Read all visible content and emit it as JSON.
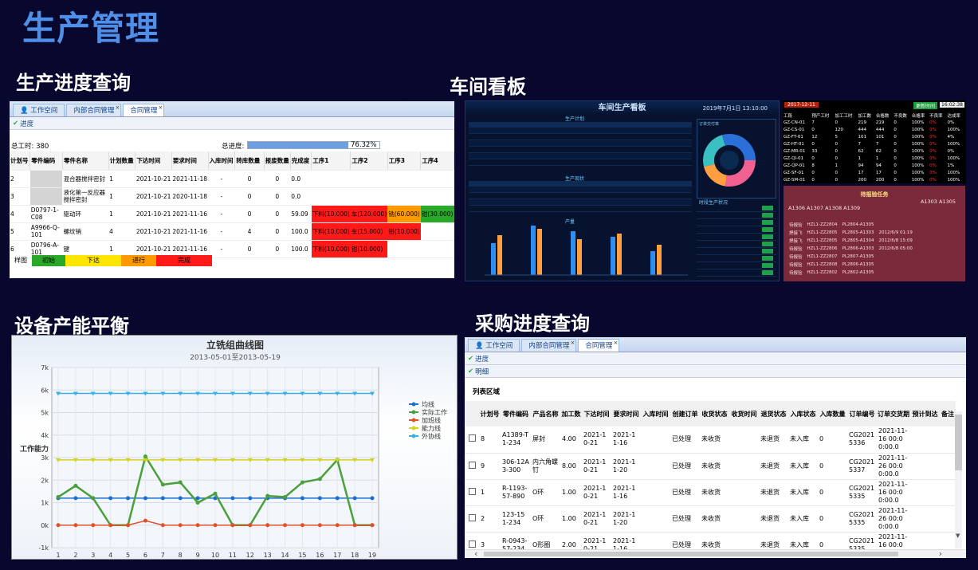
{
  "title": "生产管理",
  "sections": {
    "progress": "生产进度查询",
    "workshop": "车间看板",
    "capacity": "设备产能平衡",
    "purchase": "采购进度查询"
  },
  "p1": {
    "tabs": [
      "工作空间",
      "内部合同管理",
      "合同管理"
    ],
    "sub": "进度",
    "total_label": "总工时:",
    "total_value": "380",
    "progress_label": "总进度:",
    "progress_value": "76.32%",
    "progress_fraction": 0.7632,
    "headers": [
      "计划号",
      "零件编码",
      "零件名称",
      "计划数量",
      "下达时间",
      "要求时间",
      "入库时间",
      "转库数量",
      "报废数量",
      "完成度",
      "工序1",
      "工序2",
      "工序3",
      "工序4"
    ],
    "rows": [
      {
        "id": "2",
        "code": "",
        "name": "混合器搅拌密封",
        "qty": "1",
        "issue": "2021-10-21",
        "req": "2021-11-18",
        "in": "-",
        "tr": "0",
        "sc": "0",
        "done": "0.0",
        "steps": []
      },
      {
        "id": "3",
        "code": "",
        "name": "液化第一反应器搅拌密封",
        "qty": "1",
        "issue": "2021-10-21",
        "req": "2020-11-18",
        "in": "-",
        "tr": "0",
        "sc": "0",
        "done": "0.0",
        "steps": []
      },
      {
        "id": "4",
        "code": "D0797-1-C08",
        "name": "驱动环",
        "qty": "1",
        "issue": "2021-10-21",
        "req": "2021-11-16",
        "in": "-",
        "tr": "0",
        "sc": "0",
        "done": "59.09",
        "steps": [
          [
            "下料(10.000)",
            "r"
          ],
          [
            "车(120.000)",
            "r"
          ],
          [
            "铣(60.000)",
            "o"
          ],
          [
            "钳(30.000)",
            "g"
          ]
        ]
      },
      {
        "id": "5",
        "code": "A9966-Q-101",
        "name": "螺纹销",
        "qty": "4",
        "issue": "2021-10-21",
        "req": "2021-11-16",
        "in": "-",
        "tr": "4",
        "sc": "0",
        "done": "100.0",
        "steps": [
          [
            "下料(10.000)",
            "r"
          ],
          [
            "车(15.000)",
            "r"
          ],
          [
            "钳(10.000)",
            "r"
          ]
        ]
      },
      {
        "id": "6",
        "code": "D0796-A-101",
        "name": "键",
        "qty": "1",
        "issue": "2021-10-21",
        "req": "2021-11-16",
        "in": "-",
        "tr": "0",
        "sc": "0",
        "done": "100.0",
        "steps": [
          [
            "下料(10.000)",
            "r"
          ],
          [
            "钳(10.000)",
            "r"
          ]
        ]
      }
    ],
    "legend": [
      "样图",
      "初始",
      "下达",
      "进行",
      "完成"
    ]
  },
  "p2": {
    "title": "车间生产看板",
    "date": "2019年7月1日 13:10:00",
    "plan": "生产计划",
    "status": "生产现状",
    "output": "产量",
    "shift": "时段生产状况",
    "alloc": "订单交付率",
    "right_date": "2017-12-11",
    "right_btn": "更新时间",
    "right_time": "16:02:38",
    "right_head": [
      "工段",
      "预产工时",
      "加工工时",
      "加工数",
      "合格数",
      "不良数",
      "合格率",
      "不良率",
      "达成率"
    ],
    "right_rows": [
      [
        "GZ-CN-01",
        "7",
        "0",
        "219",
        "219",
        "0",
        "100%",
        "0%",
        "0%"
      ],
      [
        "GZ-CS-01",
        "0",
        "120",
        "444",
        "444",
        "0",
        "100%",
        "0%",
        "100%"
      ],
      [
        "GZ-FT-01",
        "12",
        "5",
        "101",
        "101",
        "0",
        "100%",
        "0%",
        "4%"
      ],
      [
        "GZ-HT-01",
        "0",
        "0",
        "7",
        "7",
        "0",
        "100%",
        "0%",
        "100%"
      ],
      [
        "GZ-MR-01",
        "33",
        "0",
        "62",
        "62",
        "0",
        "100%",
        "0%",
        "0%"
      ],
      [
        "GZ-QI-01",
        "0",
        "0",
        "1",
        "1",
        "0",
        "100%",
        "0%",
        "100%"
      ],
      [
        "GZ-QP-01",
        "8",
        "1",
        "94",
        "94",
        "0",
        "100%",
        "0%",
        "1%"
      ],
      [
        "GZ-SF-01",
        "0",
        "0",
        "17",
        "17",
        "0",
        "100%",
        "0%",
        "100%"
      ],
      [
        "GZ-SM-01",
        "0",
        "0",
        "200",
        "200",
        "0",
        "100%",
        "0%",
        "100%"
      ]
    ],
    "led_title": "待报验任务",
    "led_line1": "A1303 A1305",
    "led_line2": "A1306 A1307 A1308 A1309",
    "led_rows": [
      [
        "待报验",
        "HZL1-ZZ2804",
        "PL2804-A1305",
        ""
      ],
      [
        "焊接飞",
        "HZL1-ZZ2805",
        "PL2805-A1303",
        "2012/6/9 01:19"
      ],
      [
        "焊接飞",
        "HZL1-ZZ2805",
        "PL2805-A1304",
        "2012/6/8 15:09"
      ],
      [
        "待报验",
        "HZL1-ZZ2806",
        "PL2806-A1303",
        "2012/6/8 05:00"
      ],
      [
        "待报验",
        "HZL1-ZZ2807",
        "PL2807-A1305",
        ""
      ],
      [
        "待报验",
        "HZL1-ZZ2808",
        "PL2806-A1305",
        ""
      ],
      [
        "待报验",
        "HZL1-ZZ2802",
        "PL2802-A1305",
        ""
      ]
    ]
  },
  "p3": {
    "chart_data": {
      "type": "line",
      "title": "立铣组曲线图",
      "subtitle": "2013-05-01至2013-05-19",
      "ylabel": "工作能力",
      "x": [
        1,
        2,
        3,
        4,
        5,
        6,
        7,
        8,
        9,
        10,
        11,
        12,
        13,
        14,
        15,
        16,
        17,
        18,
        19
      ],
      "yticks": [
        "-1k",
        "0k",
        "1k",
        "2k",
        "3k",
        "4k",
        "5k",
        "6k",
        "7k"
      ],
      "ylim": [
        -1000,
        7000
      ],
      "series": [
        {
          "name": "均线",
          "color": "#1a6fd0",
          "values": [
            1200,
            1200,
            1200,
            1200,
            1200,
            1200,
            1200,
            1200,
            1200,
            1200,
            1200,
            1200,
            1200,
            1200,
            1200,
            1200,
            1200,
            1200,
            1200
          ]
        },
        {
          "name": "实际工作",
          "color": "#4aa03c",
          "values": [
            1250,
            1750,
            1200,
            0,
            0,
            3050,
            1800,
            1900,
            1000,
            1400,
            0,
            0,
            1300,
            1250,
            1900,
            2050,
            2900,
            0,
            0
          ]
        },
        {
          "name": "加班线",
          "color": "#e0502a",
          "values": [
            0,
            0,
            0,
            0,
            0,
            200,
            0,
            0,
            0,
            0,
            0,
            0,
            0,
            0,
            0,
            0,
            0,
            0,
            0
          ]
        },
        {
          "name": "能力线",
          "color": "#d4d21c",
          "values": [
            2900,
            2900,
            2900,
            2900,
            2900,
            2900,
            2900,
            2900,
            2900,
            2900,
            2900,
            2900,
            2900,
            2900,
            2900,
            2900,
            2900,
            2900,
            2900
          ]
        },
        {
          "name": "外协线",
          "color": "#3ab0e8",
          "values": [
            5850,
            5850,
            5850,
            5850,
            5850,
            5850,
            5850,
            5850,
            5850,
            5850,
            5850,
            5850,
            5850,
            5850,
            5850,
            5850,
            5850,
            5850,
            5850
          ]
        }
      ]
    }
  },
  "p4": {
    "tabs": [
      "工作空间",
      "内部合同管理",
      "合同管理"
    ],
    "sub1": "进度",
    "sub2": "明细",
    "region": "列表区域",
    "headers": [
      "",
      "计划号",
      "零件编码",
      "产品名称",
      "加工数",
      "下达时间",
      "要求时间",
      "入库时间",
      "创建订单",
      "收货状态",
      "收货时间",
      "退货状态",
      "入库状态",
      "入库数量",
      "订单编号",
      "订单交货期",
      "预计到达",
      "备注"
    ],
    "rows": [
      [
        "8",
        "A1389-T1-234",
        "屏封",
        "4.00",
        "2021-10-21",
        "2021-11-16",
        "",
        "已处理",
        "未收货",
        "",
        "未退货",
        "未入库",
        "0",
        "CG20215336",
        "2021-11-16 00:00:00.0"
      ],
      [
        "9",
        "306-12A3-300",
        "内六角螺钉",
        "8.00",
        "2021-10-21",
        "2021-11-20",
        "",
        "已处理",
        "未收货",
        "",
        "未退货",
        "未入库",
        "0",
        "CG20215337",
        "2021-11-26 00:00:00.0"
      ],
      [
        "1",
        "R-1193-57-890",
        "O环",
        "1.00",
        "2021-10-21",
        "2021-11-16",
        "",
        "已处理",
        "未收货",
        "",
        "未退货",
        "未入库",
        "0",
        "CG20215335",
        "2021-11-16 00:00:00.0"
      ],
      [
        "2",
        "123-15 1-234",
        "O环",
        "1.00",
        "2021-10-21",
        "2021-11-20",
        "",
        "已处理",
        "未收货",
        "",
        "未退货",
        "未入库",
        "0",
        "CG20215335",
        "2021-11-26 00:00:00.0"
      ],
      [
        "3",
        "R-0943-57-234",
        "O形圈",
        "2.00",
        "2021-10-21",
        "2021-11-16",
        "",
        "已处理",
        "未收货",
        "",
        "未退货",
        "未入库",
        "0",
        "CG20215335",
        "2021-11-16 00:00:00.0"
      ]
    ]
  }
}
